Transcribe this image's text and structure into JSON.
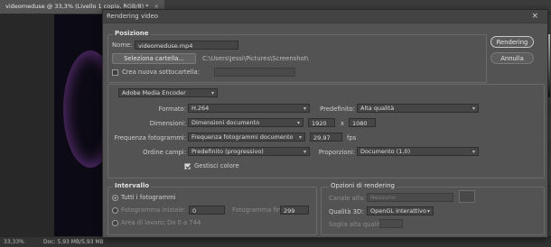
{
  "photoshop": {
    "doc_tab": "videomeduse @ 33,3% (Livello 1 copia, RGB/8) *",
    "tab_close": "×",
    "status_zoom": "33,33%",
    "status_info": "Doc: 5,93 MB/5,93 MB"
  },
  "dialog": {
    "title": "Rendering video",
    "close": "×",
    "buttons": {
      "render": "Rendering",
      "cancel": "Annulla"
    },
    "position": {
      "section": "Posizione",
      "name_label": "Nome:",
      "name_value": "videomeduse.mp4",
      "select_folder": "Seleziona cartella...",
      "folder_path": "C:\\Users\\Jessi\\Pictures\\Screenshot\\",
      "new_subfolder": "Crea nuova sottocartella:"
    },
    "encoder": {
      "value": "Adobe Media Encoder",
      "format_label": "Formato:",
      "format_value": "H.264",
      "preset_label": "Predefinito:",
      "preset_value": "Alta qualità",
      "size_label": "Dimensioni:",
      "size_value": "Dimensioni documento",
      "width": "1920",
      "x": "x",
      "height": "1080",
      "fps_label": "Frequenza fotogrammi:",
      "fps_select": "Frequenza fotogrammi documento",
      "fps_value": "29,97",
      "fps_unit": "fps",
      "field_order_label": "Ordine campi:",
      "field_order_value": "Predefinito (progressivo)",
      "aspect_label": "Proporzioni:",
      "aspect_value": "Documento (1,0)",
      "color_manage": "Gestisci colore",
      "color_manage_checked": true
    },
    "interval": {
      "section": "Intervallo",
      "all_frames": "Tutti i fotogrammi",
      "start_label": "Fotogramma iniziale:",
      "start_value": "0",
      "end_label": "Fotogramma finale:",
      "end_value": "299",
      "work_area": "Area di lavoro:",
      "work_area_value": "Da 0 a 744"
    },
    "render_options": {
      "section": "Opzioni di rendering",
      "alpha_label": "Canale alfa:",
      "alpha_value": "Nessuno",
      "quality_label": "Qualità 3D:",
      "quality_value": "OpenGL interattivo",
      "threshold_label": "Soglia alta qualità:"
    }
  }
}
